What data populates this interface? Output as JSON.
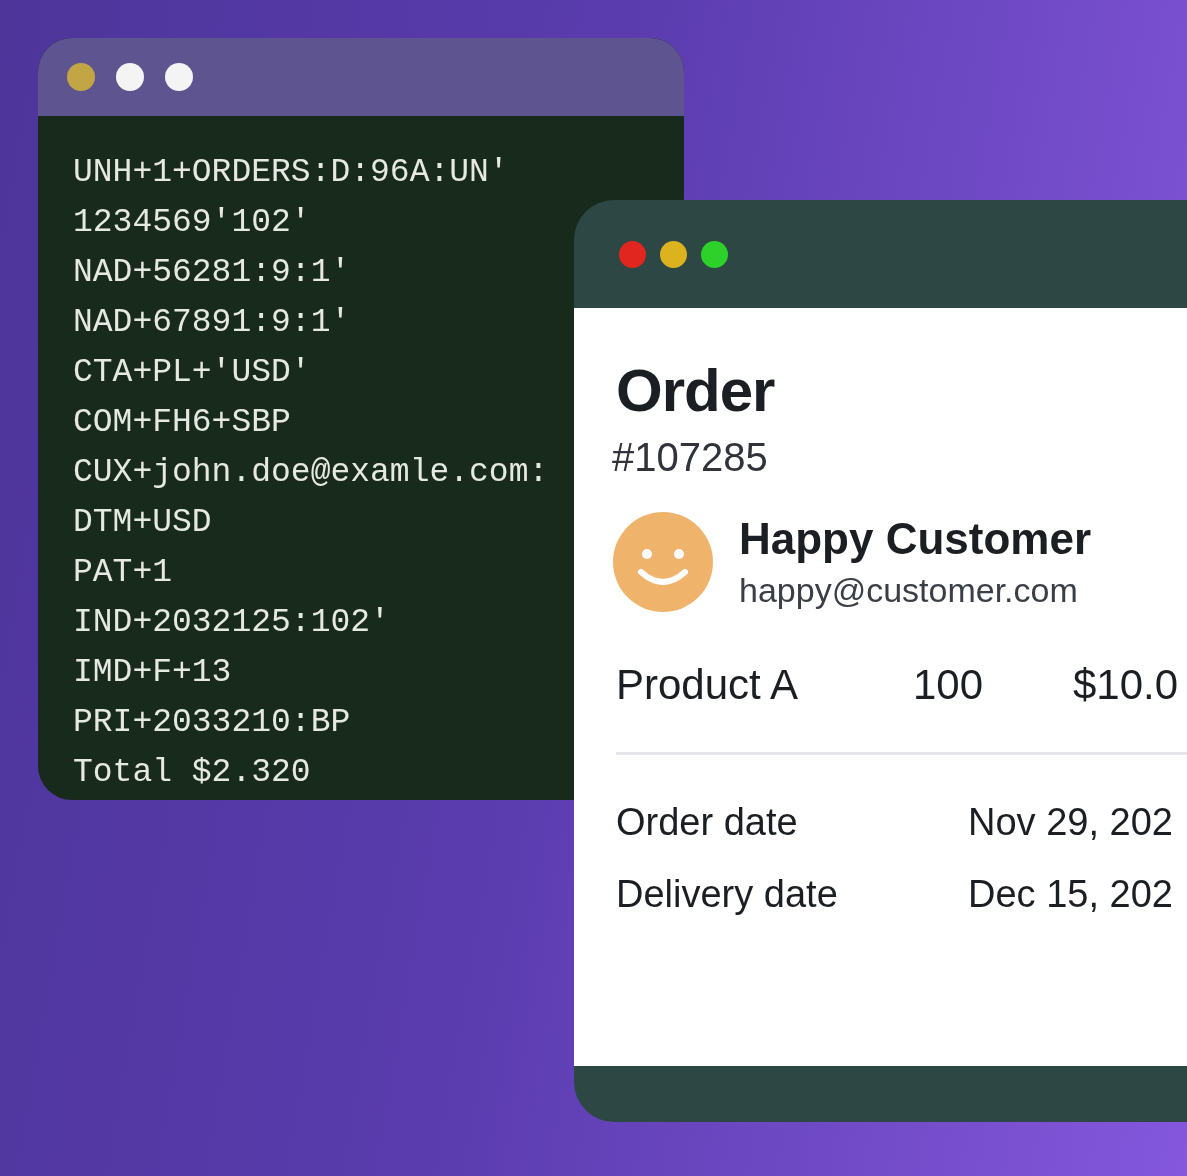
{
  "code_window": {
    "dots": [
      {
        "color": "#c2a544"
      },
      {
        "color": "#f4f4f4"
      },
      {
        "color": "#f4f4f4"
      }
    ],
    "lines": [
      "UNH+1+ORDERS:D:96A:UN'",
      "1234569'102'",
      "NAD+56281:9:1'",
      "NAD+67891:9:1'",
      "CTA+PL+'USD'",
      "COM+FH6+SBP",
      "CUX+john.doe@examle.com:",
      "DTM+USD",
      "PAT+1",
      "IND+2032125:102'",
      "IMD+F+13",
      "PRI+2033210:BP",
      "Total $2.320"
    ]
  },
  "order_window": {
    "dots": [
      {
        "color": "#e0261e"
      },
      {
        "color": "#dcb21e"
      },
      {
        "color": "#2ed12a"
      }
    ],
    "title": "Order",
    "number": "#107285",
    "customer": {
      "name": "Happy Customer",
      "email": "happy@customer.com"
    },
    "product": {
      "name": "Product A",
      "quantity": "100",
      "price": "$10.0"
    },
    "details": [
      {
        "label": "Order date",
        "value": "Nov 29, 202"
      },
      {
        "label": "Delivery date",
        "value": "Dec 15, 202"
      }
    ]
  }
}
